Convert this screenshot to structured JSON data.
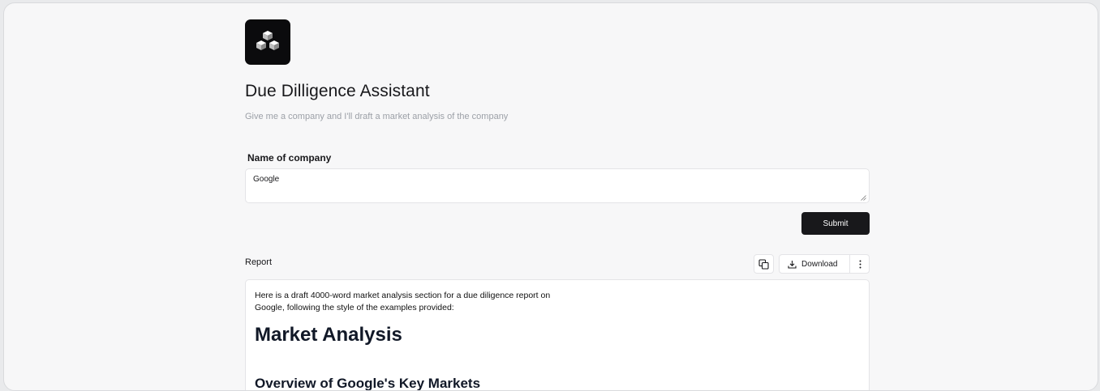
{
  "app": {
    "title": "Due Dilligence Assistant",
    "subtitle": "Give me a company and I'll draft a market analysis of the company"
  },
  "form": {
    "field_label": "Name of company",
    "company_value": "Google",
    "submit_label": "Submit"
  },
  "report": {
    "label": "Report",
    "download_label": "Download",
    "intro_line1": "Here is a draft 4000-word market analysis section for a due diligence report on",
    "intro_line2": "Google, following the style of the examples provided:",
    "heading": "Market Analysis",
    "subheading": "Overview of Google's Key Markets"
  },
  "colors": {
    "accent": "#18181b",
    "background": "#f7f7f8",
    "muted_text": "#9ca0a7"
  },
  "icons": {
    "logo": "cube-logo",
    "copy": "copy-icon",
    "download": "download-icon",
    "more": "more-vertical-icon"
  }
}
